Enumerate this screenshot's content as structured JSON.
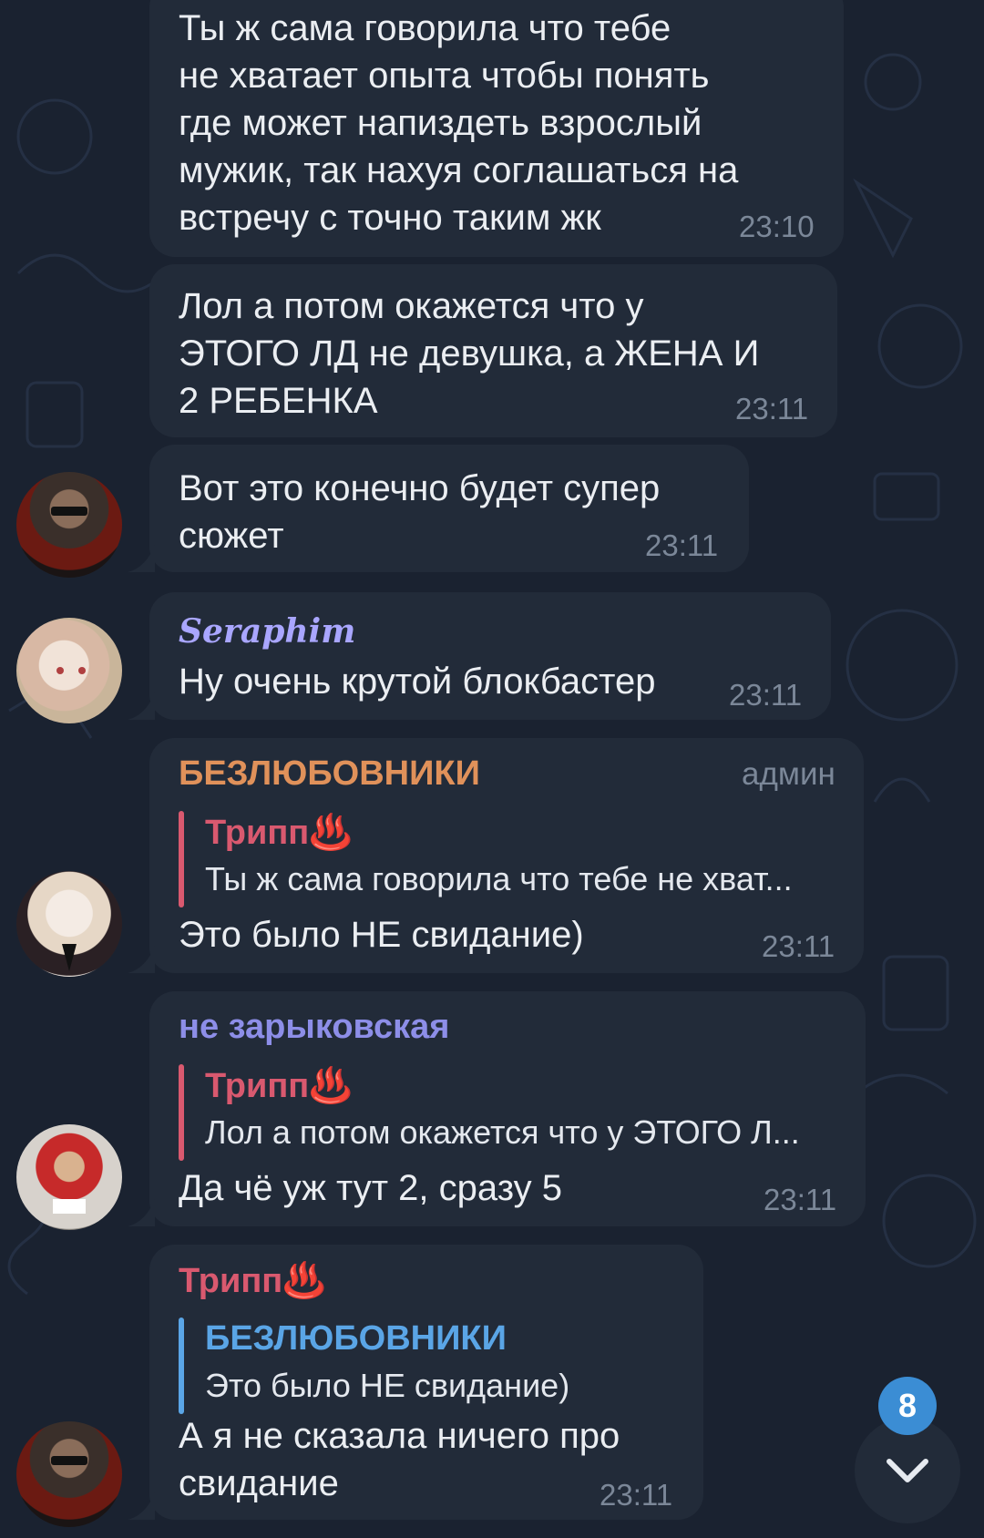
{
  "messages": [
    {
      "lines": [
        "Ты ж сама говорила что тебе",
        "не хватает опыта чтобы понять",
        "где может напиздеть взрослый",
        "мужик, так нахуя соглашаться на",
        "встречу с точно таким жк"
      ],
      "time": "23:10"
    },
    {
      "lines": [
        "Лол а потом окажется что у",
        "ЭТОГО ЛД не девушка, а ЖЕНА И",
        "2 РЕБЕНКА"
      ],
      "time": "23:11"
    },
    {
      "lines": [
        "Вот это конечно будет супер",
        "сюжет"
      ],
      "time": "23:11"
    },
    {
      "sender": "Seraphim",
      "lines": [
        "Ну очень крутой блокбастер"
      ],
      "time": "23:11"
    },
    {
      "sender": "БЕЗЛЮБОВНИКИ",
      "role": "админ",
      "reply_name": "Трипп♨️",
      "reply_text": "Ты ж сама говорила что тебе не хват...",
      "lines": [
        "Это было НЕ свидание)"
      ],
      "time": "23:11"
    },
    {
      "sender": "не зарыковская",
      "reply_name": "Трипп♨️",
      "reply_text": "Лол а потом окажется что у ЭТОГО Л...",
      "lines": [
        "Да чё уж тут 2, сразу 5"
      ],
      "time": "23:11"
    },
    {
      "sender": "Трипп♨️",
      "reply_name": "БЕЗЛЮБОВНИКИ",
      "reply_text": "Это было НЕ свидание)",
      "lines": [
        "А я не сказала ничего про",
        "свидание"
      ],
      "time": "23:11"
    }
  ],
  "scroll_button": {
    "icon": "chevron-down-icon",
    "unread_count": "8"
  },
  "colors": {
    "background": "#1a2230",
    "bubble": "#222b39",
    "sender_orange": "#e0915a",
    "sender_purple": "#8d8ee8",
    "sender_pink": "#d9596f",
    "reply_blue": "#5aa5e6",
    "badge": "#3b8dd4"
  }
}
